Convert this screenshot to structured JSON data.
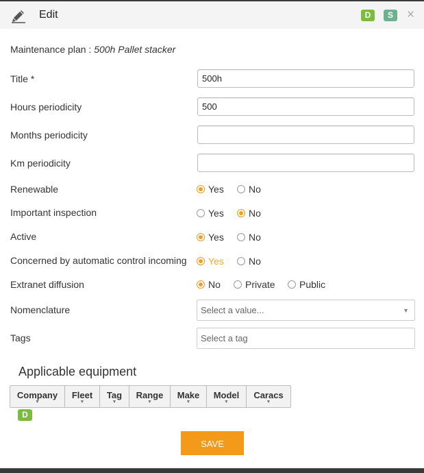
{
  "header": {
    "title": "Edit",
    "badge_d": "D",
    "badge_s": "S",
    "close": "×"
  },
  "plan": {
    "label": "Maintenance plan : ",
    "name": "500h Pallet stacker"
  },
  "fields": {
    "title": {
      "label": "Title *",
      "value": "500h"
    },
    "hours": {
      "label": "Hours periodicity",
      "value": "500"
    },
    "months": {
      "label": "Months periodicity",
      "value": ""
    },
    "km": {
      "label": "Km periodicity",
      "value": ""
    }
  },
  "radios": {
    "renewable": {
      "label": "Renewable",
      "options": [
        "Yes",
        "No"
      ],
      "selected": "Yes"
    },
    "important": {
      "label": "Important inspection",
      "options": [
        "Yes",
        "No"
      ],
      "selected": "No"
    },
    "active": {
      "label": "Active",
      "options": [
        "Yes",
        "No"
      ],
      "selected": "Yes"
    },
    "concerned": {
      "label": "Concerned by automatic control incoming",
      "options": [
        "Yes",
        "No"
      ],
      "selected": "Yes"
    },
    "extranet": {
      "label": "Extranet diffusion",
      "options": [
        "No",
        "Private",
        "Public"
      ],
      "selected": "No"
    }
  },
  "nomenclature": {
    "label": "Nomenclature",
    "placeholder": "Select a value..."
  },
  "tags": {
    "label": "Tags",
    "placeholder": "Select a tag"
  },
  "equipment": {
    "title": "Applicable equipment",
    "columns": [
      "Company",
      "Fleet",
      "Tag",
      "Range",
      "Make",
      "Model",
      "Caracs"
    ],
    "badge": "D"
  },
  "save_label": "SAVE",
  "colors": {
    "accent": "#f39a1a",
    "badge_green": "#7dbb3f",
    "badge_teal": "#6fb08e"
  }
}
